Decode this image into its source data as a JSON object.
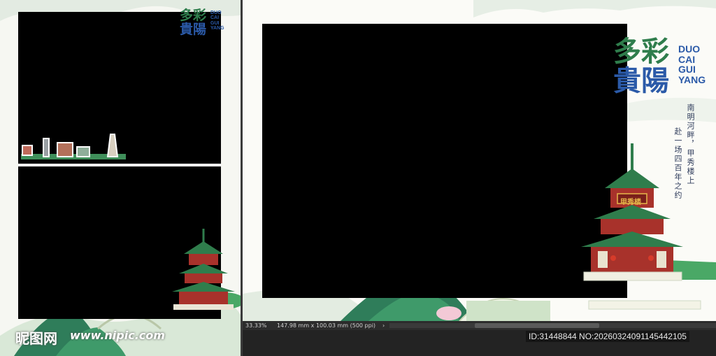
{
  "logo": {
    "chinese_line1": "多彩",
    "chinese_line2": "貴陽",
    "pinyin": [
      "DUO",
      "CAI",
      "GUI",
      "YANG"
    ]
  },
  "tagline": {
    "line1": "南明河畔，甲秀楼上",
    "line2": "赴一场四百年之约"
  },
  "pavilion_sign": "甲秀楼",
  "status_bar": {
    "zoom": "33.33%",
    "document_info": "147.98 mm x 100.03 mm (500 ppi)",
    "arrow": "›"
  },
  "watermark": {
    "site_cn": "昵图网",
    "site_url": "www.nipic.com",
    "id_line": "ID:31448844 NO:20260324091145442105"
  },
  "colors": {
    "logo_green": "#2f7d4c",
    "logo_red": "#c0392b",
    "logo_blue": "#2b5aa8",
    "logo_brown": "#8b5a2b",
    "pavilion_green": "#2f7d4c",
    "pavilion_red": "#a8322b",
    "gold": "#e6b64a"
  }
}
